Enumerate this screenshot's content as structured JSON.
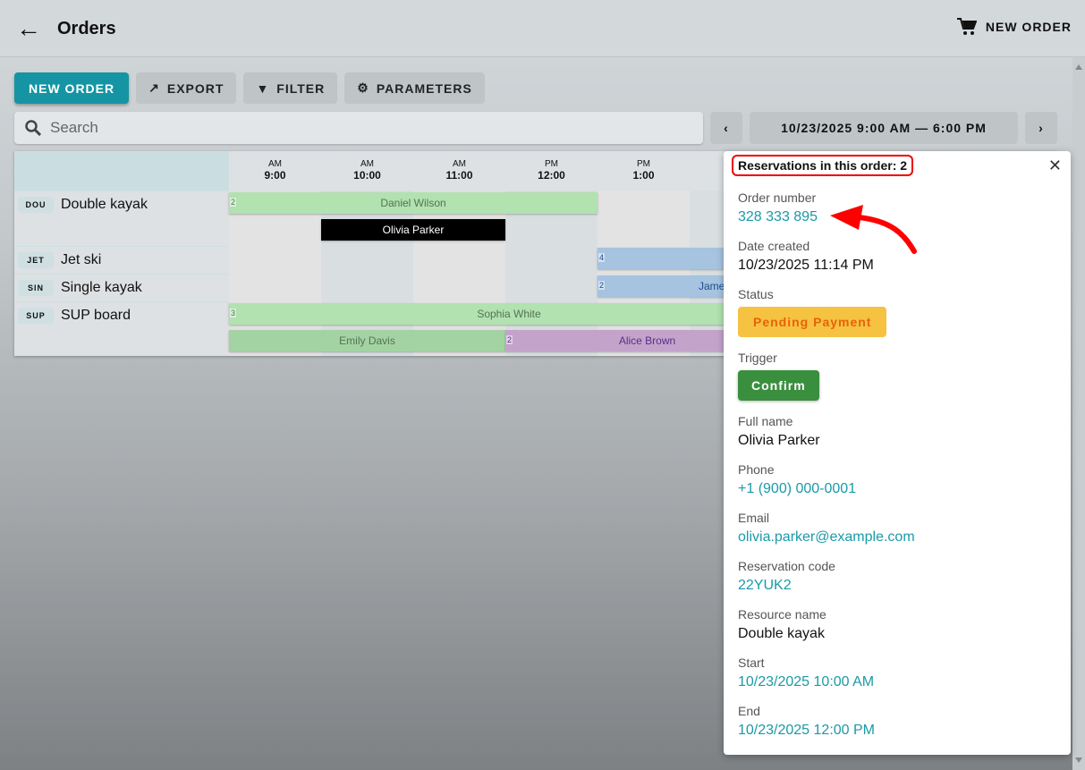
{
  "header": {
    "title": "Orders",
    "new_order": "NEW ORDER"
  },
  "toolbar": {
    "new_order": "NEW ORDER",
    "export": "EXPORT",
    "filter": "FILTER",
    "parameters": "PARAMETERS"
  },
  "search": {
    "placeholder": "Search"
  },
  "date_range": "10/23/2025 9:00 AM — 6:00 PM",
  "hours": [
    {
      "p": "AM",
      "t": "9:00"
    },
    {
      "p": "AM",
      "t": "10:00"
    },
    {
      "p": "AM",
      "t": "11:00"
    },
    {
      "p": "PM",
      "t": "12:00"
    },
    {
      "p": "PM",
      "t": "1:00"
    }
  ],
  "resources": [
    {
      "code": "DOU",
      "name": "Double kayak"
    },
    {
      "code": "JET",
      "name": "Jet ski"
    },
    {
      "code": "SIN",
      "name": "Single kayak"
    },
    {
      "code": "SUP",
      "name": "SUP board"
    }
  ],
  "bookings": {
    "daniel": {
      "name": "Daniel Wilson",
      "n": "2"
    },
    "olivia": {
      "name": "Olivia Parker"
    },
    "jet": {
      "n": "4"
    },
    "james": {
      "name": "James",
      "n": "2"
    },
    "sophia": {
      "name": "Sophia White",
      "n": "3"
    },
    "emily": {
      "name": "Emily Davis"
    },
    "alice": {
      "name": "Alice Brown",
      "n": "2"
    }
  },
  "panel": {
    "reservations": "Reservations in this order: 2",
    "order_number_label": "Order number",
    "order_number": "328 333 895",
    "date_created_label": "Date created",
    "date_created": "10/23/2025 11:14 PM",
    "status_label": "Status",
    "status": "Pending Payment",
    "trigger_label": "Trigger",
    "trigger": "Confirm",
    "full_name_label": "Full name",
    "full_name": "Olivia Parker",
    "phone_label": "Phone",
    "phone": "+1 (900) 000-0001",
    "email_label": "Email",
    "email": "olivia.parker@example.com",
    "code_label": "Reservation code",
    "code": "22YUK2",
    "resource_label": "Resource name",
    "resource": "Double kayak",
    "start_label": "Start",
    "start": "10/23/2025 10:00 AM",
    "end_label": "End",
    "end": "10/23/2025 12:00 PM"
  },
  "colors": {
    "accent": "#1595a3",
    "pending": "#f5c242",
    "confirm": "#3a8f3e",
    "annotation": "#ee0000"
  }
}
